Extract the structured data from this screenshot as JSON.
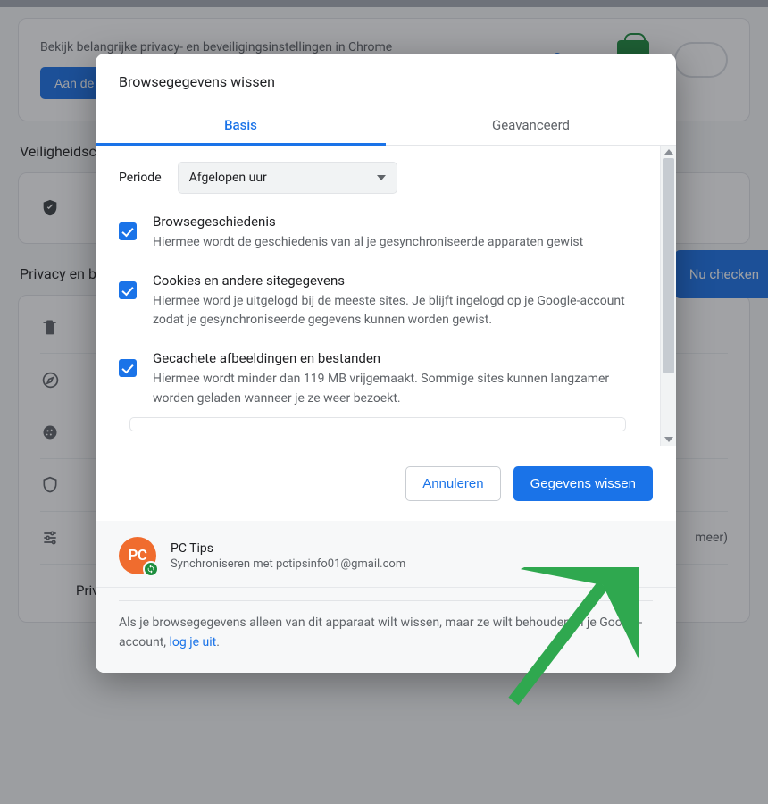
{
  "backdrop": {
    "hero_text": "Bekijk belangrijke privacy- en beveiligingsinstellingen in Chrome",
    "hero_btn": "Aan de slag",
    "section_safety": "Veiligheidscheck",
    "nu_checken": "Nu checken",
    "section_privacy": "Privacy en beveiliging",
    "meer": "meer)",
    "sandbox": "Privacy Sandbox"
  },
  "dialog": {
    "title": "Browsegegevens wissen",
    "tabs": {
      "basic": "Basis",
      "advanced": "Geavanceerd"
    },
    "period_label": "Periode",
    "period_value": "Afgelopen uur",
    "options": [
      {
        "title": "Browsegeschiedenis",
        "desc": "Hiermee wordt de geschiedenis van al je gesynchroniseerde apparaten gewist"
      },
      {
        "title": "Cookies en andere sitegegevens",
        "desc": "Hiermee word je uitgelogd bij de meeste sites. Je blijft ingelogd op je Google-account zodat je gesynchroniseerde gegevens kunnen worden gewist."
      },
      {
        "title": "Gecachete afbeeldingen en bestanden",
        "desc": "Hiermee wordt minder dan 119 MB vrijgemaakt. Sommige sites kunnen langzamer worden geladen wanneer je ze weer bezoekt."
      }
    ],
    "cancel": "Annuleren",
    "confirm": "Gegevens wissen",
    "account": {
      "initials": "PC",
      "name": "PC Tips",
      "sync_line": "Synchroniseren met pctipsinfo01@gmail.com"
    },
    "footnote_pre": "Als je browsegegevens alleen van dit apparaat wilt wissen, maar ze wilt behouden in je Google-account, ",
    "footnote_link": "log je uit",
    "footnote_post": "."
  }
}
